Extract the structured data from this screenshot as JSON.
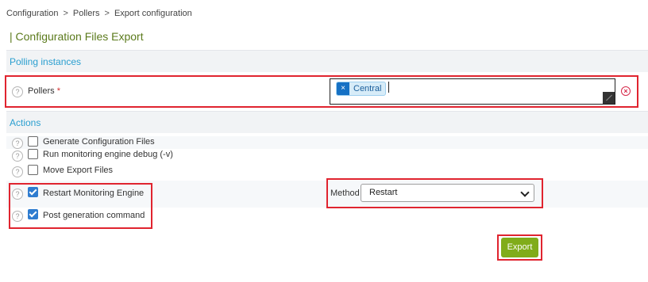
{
  "breadcrumb": {
    "items": [
      "Configuration",
      "Pollers",
      "Export configuration"
    ],
    "separator": ">"
  },
  "page_title": "| Configuration Files Export",
  "polling_section": {
    "title": "Polling instances",
    "pollers_label": "Pollers",
    "required_mark": "*",
    "selected_pollers": [
      "Central"
    ],
    "chip_remove_glyph": "×"
  },
  "actions_section": {
    "title": "Actions",
    "options": [
      {
        "label": "Generate Configuration Files",
        "checked": false
      },
      {
        "label": "Run monitoring engine debug (-v)",
        "checked": false
      },
      {
        "label": "Move Export Files",
        "checked": false
      },
      {
        "label": "Restart Monitoring Engine",
        "checked": true
      },
      {
        "label": "Post generation command",
        "checked": true
      }
    ],
    "method_label": "Method",
    "method_value": "Restart"
  },
  "help_glyph": "?",
  "export_button_label": "Export",
  "colors": {
    "title_green": "#5b7a1c",
    "section_blue": "#2b9fd0",
    "highlight_red": "#e0242f",
    "button_green": "#80ac1a",
    "checkbox_blue": "#2e7cd0"
  }
}
